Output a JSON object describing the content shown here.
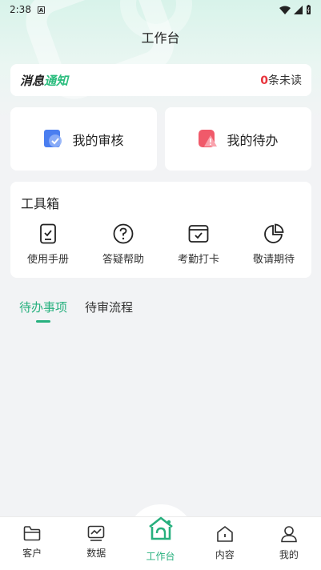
{
  "status_bar": {
    "time": "2:38",
    "a_label": "A"
  },
  "page": {
    "title": "工作台"
  },
  "message": {
    "title_part1": "消息",
    "title_part2": "通知",
    "unread_count": "0",
    "unread_suffix": "条未读"
  },
  "quick": [
    {
      "label": "我的审核",
      "icon": "review-shield-icon"
    },
    {
      "label": "我的待办",
      "icon": "todo-warning-icon"
    }
  ],
  "toolbox": {
    "title": "工具箱",
    "items": [
      {
        "label": "使用手册",
        "icon": "manual-icon"
      },
      {
        "label": "答疑帮助",
        "icon": "help-icon"
      },
      {
        "label": "考勤打卡",
        "icon": "attendance-icon"
      },
      {
        "label": "敬请期待",
        "icon": "pie-chart-icon"
      }
    ]
  },
  "tabs": [
    {
      "label": "待办事项",
      "active": true
    },
    {
      "label": "待审流程",
      "active": false
    }
  ],
  "bottom_nav": [
    {
      "label": "客户",
      "icon": "folder-icon"
    },
    {
      "label": "数据",
      "icon": "chart-icon"
    },
    {
      "label": "工作台",
      "icon": "home-workbench-icon",
      "active": true
    },
    {
      "label": "内容",
      "icon": "content-house-icon"
    },
    {
      "label": "我的",
      "icon": "person-icon"
    }
  ],
  "colors": {
    "accent": "#27b07e",
    "unread": "#e8343c"
  }
}
